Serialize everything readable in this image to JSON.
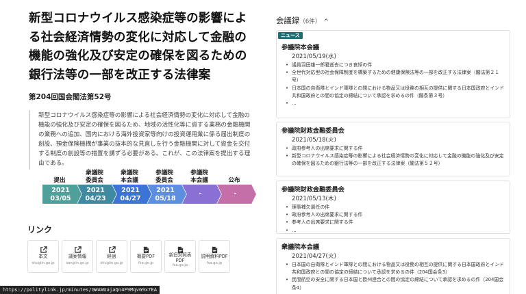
{
  "bill": {
    "title": "新型コロナウイルス感染症等の影響による社会経済情勢の変化に対応して金融の機能の強化及び安定の確保を図るための銀行法等の一部を改正する法律案",
    "number": "第204回国会閣法第52号",
    "summary": "新型コロナウイルス感染症等の影響による社会経済情勢の変化に対応して金融の機能の強化及び安定の確保を図るため、地域の活性化等に資する業務の金融機関の業務への追加、国内における海外投資家等向けの投資運用業に係る届出制度の創設、預金保険機構が事業の抜本的な見直しを行う金融機関に対して資金を交付する制度の創設等の措置を講ずる必要がある。これが、この法律案を提出する理由である。"
  },
  "timeline": [
    {
      "label": "提出",
      "date_year": "2021",
      "date_md": "03/05",
      "color": "#4f9f9b"
    },
    {
      "label": "衆議院\n委員会",
      "date_year": "2021",
      "date_md": "04/23",
      "color": "#3f8aa0"
    },
    {
      "label": "衆議院\n本会議",
      "date_year": "2021",
      "date_md": "04/27",
      "color": "#3b73d6"
    },
    {
      "label": "参議院\n委員会",
      "date_year": "2021",
      "date_md": "05/18",
      "color": "#5e8ee0"
    },
    {
      "label": "参議院\n本会議",
      "date_year": "-",
      "date_md": "",
      "color": "#8a6fd4"
    },
    {
      "label": "公布",
      "date_year": "-",
      "date_md": "",
      "color": "#c46fa7"
    }
  ],
  "links": {
    "heading": "リンク",
    "items": [
      {
        "label": "本文",
        "domain": "shugiin.go.jp",
        "icon": "external-link-icon"
      },
      {
        "label": "議案情報",
        "domain": "sangiin.go.jp",
        "icon": "external-link-icon"
      },
      {
        "label": "経過",
        "domain": "shugiin.go.jp",
        "icon": "external-link-icon"
      },
      {
        "label": "概要PDF",
        "domain": "fsa.go.jp",
        "icon": "pdf-file-icon"
      },
      {
        "label": "新旧対照表\nPDF",
        "domain": "fsa.go.jp",
        "icon": "pdf-file-icon"
      },
      {
        "label": "説明資料PDF",
        "domain": "fsa.go.jp",
        "icon": "pdf-file-icon"
      }
    ]
  },
  "status_url": "https://politylink.jp/minutes/GWAWUajaQn4F9MqvG9x7EA",
  "minutes": {
    "heading": "会議録",
    "count": "（6件）",
    "collapse_icon": "chevron-up-icon",
    "cards": [
      {
        "badge": "ニュース",
        "title": "参議院本会議",
        "date": "2021/05/19(水)",
        "items": [
          "議員羽田雄一郎君逝去につき哀悼の件",
          "全世代対応型の社会保障制度を構築するための健康保険法等の一部を改正する法律案（閣法第２１号）",
          "日本国の自衛隊とインド軍隊との間における物品又は役務の相互の提供に関する日本国政府とインド共和国政府との間の協定の締結について承認を求めるの件（閣条第３号）",
          "..."
        ]
      },
      {
        "badge": "",
        "title": "参議院財政金融委員会",
        "date": "2021/05/18(火)",
        "items": [
          "政府参考人の出席要求に関する件",
          "新型コロナウイルス感染症等の影響による社会経済情勢の変化に対応して金融の機能の強化及び安定の確保を図るための銀行法等の一部を改正する法律案（閣法第５２号）"
        ]
      },
      {
        "badge": "",
        "title": "参議院財政金融委員会",
        "date": "2021/05/13(木)",
        "items": [
          "理事補欠選任の件",
          "政府参考人の出席要求に関する件",
          "参考人の出席要求に関する件",
          "..."
        ]
      },
      {
        "badge": "",
        "title": "衆議院本会議",
        "date": "2021/04/27(火)",
        "items": [
          "日本国の自衛隊とインド軍隊との間における物品又は役務の相互の提供に関する日本国政府とインド共和国政府との間の協定の締結について承認を求めるの件（204国会条3）",
          "民間航空の安全に関する日本国と欧州連合との間の協定の締結について承認を求めるの件（204国会条4）"
        ]
      }
    ]
  }
}
